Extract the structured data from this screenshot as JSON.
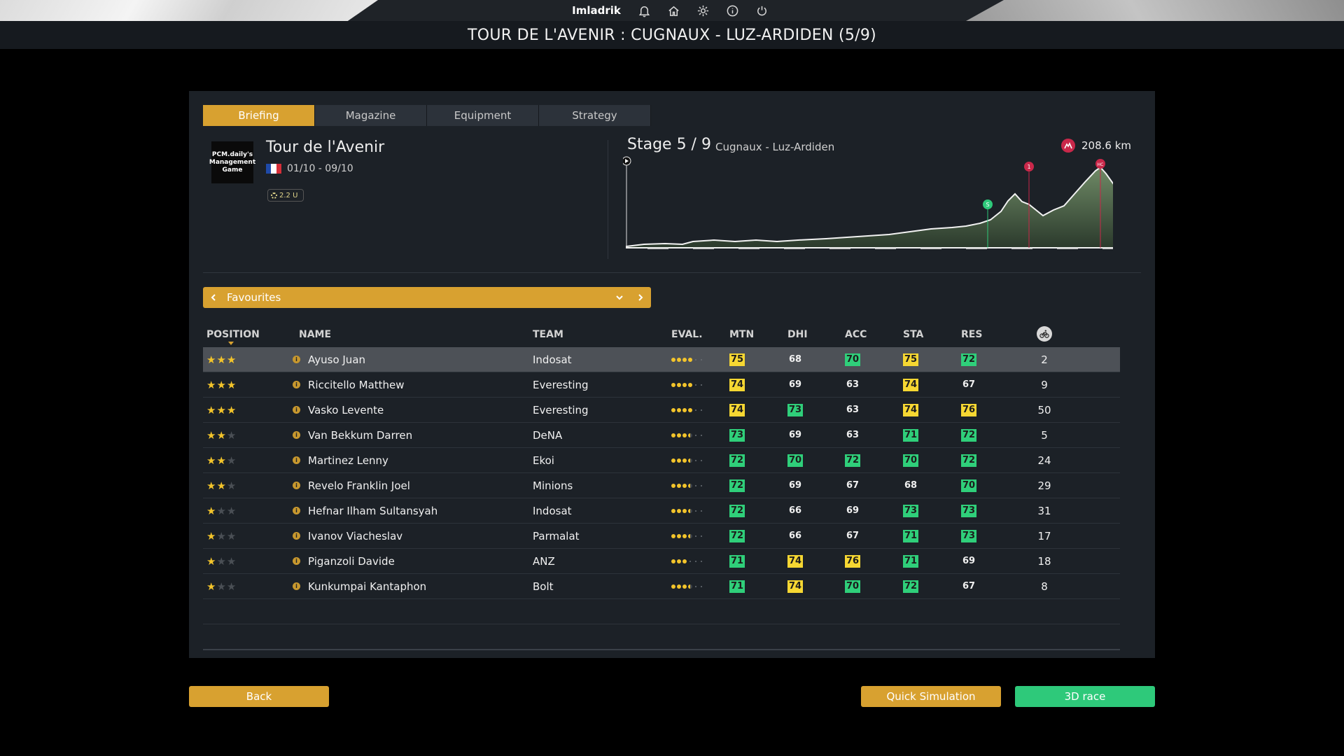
{
  "topbar": {
    "username": "Imladrik",
    "icons": [
      "bell-icon",
      "home-icon",
      "gear-icon",
      "info-icon",
      "power-icon"
    ]
  },
  "title": "TOUR DE L'AVENIR : CUGNAUX - LUZ-ARDIDEN (5/9)",
  "tabs": [
    "Briefing",
    "Magazine",
    "Equipment",
    "Strategy"
  ],
  "active_tab": "Briefing",
  "race": {
    "logo_text": "PCM.daily's Management Game",
    "name": "Tour de l'Avenir",
    "dates": "01/10 - 09/10",
    "class": "2.2 U",
    "flag_colors": [
      "#1f4aa8",
      "#ffffff",
      "#d62e38"
    ]
  },
  "stage": {
    "label": "Stage 5 / 9",
    "route": "Cugnaux - Luz-Ardiden",
    "distance": "208.6 km",
    "markers": [
      "start",
      "sprint",
      "climb-1",
      "climb-hc",
      "finish"
    ],
    "marker_labels": {
      "sprint": "S",
      "climb1": "1",
      "climbhc": "HC"
    }
  },
  "selector": {
    "label": "Favourites"
  },
  "table": {
    "headers": {
      "position": "POSITION",
      "name": "NAME",
      "team": "TEAM",
      "eval": "EVAL.",
      "mtn": "MTN",
      "dhi": "DHI",
      "acc": "ACC",
      "sta": "STA",
      "res": "RES",
      "bib_icon": "cyclist-icon"
    },
    "rows": [
      {
        "stars": 3,
        "name": "Ayuso Juan",
        "team": "Indosat",
        "eval": 4,
        "mtn": "75",
        "dhi": "68",
        "acc": "70",
        "sta": "75",
        "res": "72",
        "bib": "2"
      },
      {
        "stars": 3,
        "name": "Riccitello Matthew",
        "team": "Everesting",
        "eval": 4,
        "mtn": "74",
        "dhi": "69",
        "acc": "63",
        "sta": "74",
        "res": "67",
        "bib": "9"
      },
      {
        "stars": 3,
        "name": "Vasko Levente",
        "team": "Everesting",
        "eval": 4,
        "mtn": "74",
        "dhi": "73",
        "acc": "63",
        "sta": "74",
        "res": "76",
        "bib": "50"
      },
      {
        "stars": 2,
        "name": "Van Bekkum Darren",
        "team": "DeNA",
        "eval": 3.5,
        "mtn": "73",
        "dhi": "69",
        "acc": "63",
        "sta": "71",
        "res": "72",
        "bib": "5"
      },
      {
        "stars": 2,
        "name": "Martinez Lenny",
        "team": "Ekoi",
        "eval": 3.5,
        "mtn": "72",
        "dhi": "70",
        "acc": "72",
        "sta": "70",
        "res": "72",
        "bib": "24"
      },
      {
        "stars": 2,
        "name": "Revelo Franklin Joel",
        "team": "Minions",
        "eval": 3.5,
        "mtn": "72",
        "dhi": "69",
        "acc": "67",
        "sta": "68",
        "res": "70",
        "bib": "29"
      },
      {
        "stars": 1,
        "name": "Hefnar Ilham Sultansyah",
        "team": "Indosat",
        "eval": 3.5,
        "mtn": "72",
        "dhi": "66",
        "acc": "69",
        "sta": "73",
        "res": "73",
        "bib": "31"
      },
      {
        "stars": 1,
        "name": "Ivanov Viacheslav",
        "team": "Parmalat",
        "eval": 3.5,
        "mtn": "72",
        "dhi": "66",
        "acc": "67",
        "sta": "71",
        "res": "73",
        "bib": "17"
      },
      {
        "stars": 1,
        "name": "Piganzoli Davide",
        "team": "ANZ",
        "eval": 3,
        "mtn": "71",
        "dhi": "74",
        "acc": "76",
        "sta": "71",
        "res": "69",
        "bib": "18"
      },
      {
        "stars": 1,
        "name": "Kunkumpai Kantaphon",
        "team": "Bolt",
        "eval": 3.5,
        "mtn": "71",
        "dhi": "74",
        "acc": "70",
        "sta": "72",
        "res": "67",
        "bib": "8"
      }
    ],
    "selected_row": 0,
    "value_colors": {
      "yellow": "#f6d732",
      "green": "#2fcf7a"
    }
  },
  "buttons": {
    "back": "Back",
    "quick_sim": "Quick Simulation",
    "race3d": "3D race"
  },
  "colors": {
    "accent": "#d8a130",
    "green": "#2ec97a",
    "panel": "#1c2127"
  }
}
